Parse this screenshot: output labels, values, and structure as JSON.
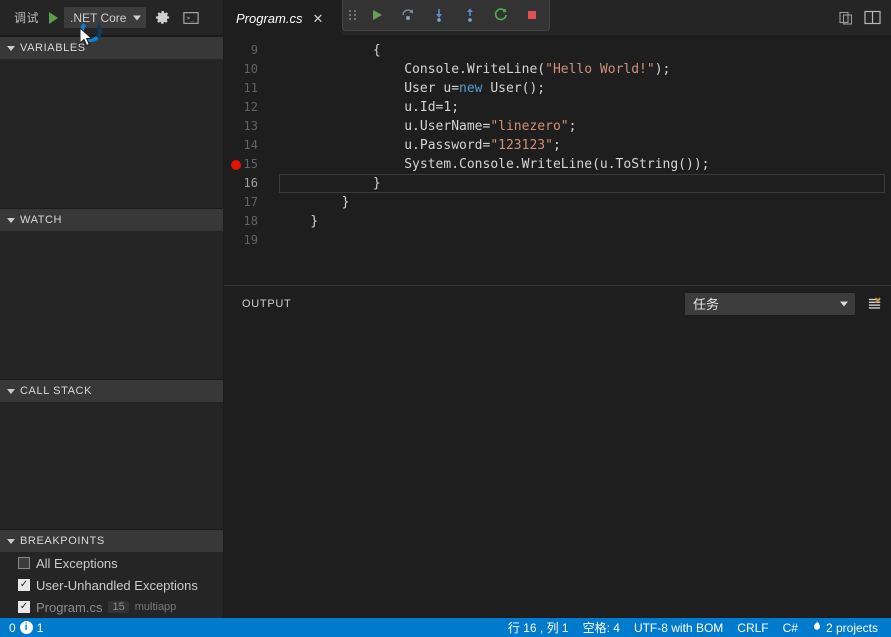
{
  "sidebar": {
    "debug_bar": {
      "label": "调试",
      "start_icon": "play-icon",
      "config_value": ".NET Core",
      "gear_icon": "gear-icon",
      "terminal_icon": "terminal-icon"
    },
    "sections": [
      {
        "title": "VARIABLES",
        "id": "variables"
      },
      {
        "title": "WATCH",
        "id": "watch"
      },
      {
        "title": "CALL STACK",
        "id": "call-stack"
      },
      {
        "title": "BREAKPOINTS",
        "id": "breakpoints"
      }
    ],
    "breakpoints": [
      {
        "label": "All Exceptions",
        "checked": false,
        "line": "",
        "project": "",
        "dim": false
      },
      {
        "label": "User-Unhandled Exceptions",
        "checked": true,
        "line": "",
        "project": "",
        "dim": false
      },
      {
        "label": "Program.cs",
        "checked": true,
        "line": "15",
        "project": "multiapp",
        "dim": true
      }
    ]
  },
  "tabbar": {
    "tabs": [
      {
        "label": "Program.cs",
        "close_icon": "close-icon",
        "active": true,
        "preview": true
      }
    ],
    "actions": [
      {
        "icon": "open-changes-icon",
        "name": "open-changes-button"
      },
      {
        "icon": "split-editor-icon",
        "name": "split-editor-button"
      }
    ]
  },
  "debug_toolbar": {
    "grip_icon": "drag-grip-icon",
    "buttons": [
      {
        "name": "continue-button",
        "icon": "play-icon",
        "label": "Continue"
      },
      {
        "name": "step-over-button",
        "icon": "step-over-icon",
        "label": "Step Over"
      },
      {
        "name": "step-into-button",
        "icon": "step-into-icon",
        "label": "Step Into"
      },
      {
        "name": "step-out-button",
        "icon": "step-out-icon",
        "label": "Step Out"
      },
      {
        "name": "restart-button",
        "icon": "restart-icon",
        "label": "Restart"
      },
      {
        "name": "stop-button",
        "icon": "stop-icon",
        "label": "Stop"
      }
    ]
  },
  "editor": {
    "language": "C#",
    "breakpoint_line": 15,
    "cursor_line": 16,
    "lines": [
      {
        "no": "9",
        "indent": 12,
        "tokens": [
          {
            "t": "{",
            "c": "pl"
          }
        ]
      },
      {
        "no": "10",
        "indent": 16,
        "tokens": [
          {
            "t": "Console.WriteLine(",
            "c": "pl"
          },
          {
            "t": "\"Hello World!\"",
            "c": "str"
          },
          {
            "t": ");",
            "c": "pl"
          }
        ]
      },
      {
        "no": "11",
        "indent": 16,
        "tokens": [
          {
            "t": "User u=",
            "c": "pl"
          },
          {
            "t": "new",
            "c": "kw"
          },
          {
            "t": " User();",
            "c": "pl"
          }
        ]
      },
      {
        "no": "12",
        "indent": 16,
        "tokens": [
          {
            "t": "u.Id=1;",
            "c": "pl"
          }
        ]
      },
      {
        "no": "13",
        "indent": 16,
        "tokens": [
          {
            "t": "u.UserName=",
            "c": "pl"
          },
          {
            "t": "\"linezero\"",
            "c": "str"
          },
          {
            "t": ";",
            "c": "pl"
          }
        ]
      },
      {
        "no": "14",
        "indent": 16,
        "tokens": [
          {
            "t": "u.Password=",
            "c": "pl"
          },
          {
            "t": "\"123123\"",
            "c": "str"
          },
          {
            "t": ";",
            "c": "pl"
          }
        ]
      },
      {
        "no": "15",
        "indent": 16,
        "tokens": [
          {
            "t": "System.Console.WriteLine(u.ToString());",
            "c": "pl"
          }
        ]
      },
      {
        "no": "16",
        "indent": 12,
        "tokens": [
          {
            "t": "}",
            "c": "pl"
          }
        ]
      },
      {
        "no": "17",
        "indent": 8,
        "tokens": [
          {
            "t": "}",
            "c": "pl"
          }
        ]
      },
      {
        "no": "18",
        "indent": 4,
        "tokens": [
          {
            "t": "}",
            "c": "pl"
          }
        ]
      },
      {
        "no": "19",
        "indent": 0,
        "tokens": []
      }
    ]
  },
  "panel": {
    "title": "OUTPUT",
    "channel_value": "任务",
    "clear_icon": "clear-output-icon",
    "content": ""
  },
  "statusbar": {
    "left": [
      {
        "name": "error-count",
        "icon": "error-icon",
        "value": "0"
      },
      {
        "name": "info-count",
        "icon": "info-icon",
        "value": "1"
      }
    ],
    "right": [
      {
        "name": "cursor-position",
        "value": "行 16 , 列 1"
      },
      {
        "name": "indentation",
        "value": "空格: 4"
      },
      {
        "name": "encoding",
        "value": "UTF-8 with BOM"
      },
      {
        "name": "eol",
        "value": "CRLF"
      },
      {
        "name": "language-mode",
        "value": "C#"
      },
      {
        "name": "projects",
        "value": "2 projects",
        "icon": "flame-icon"
      }
    ]
  },
  "colors": {
    "accent": "#007acc",
    "editor_bg": "#1e1e1e",
    "sidebar_bg": "#252526",
    "section_header_bg": "#383838",
    "breakpoint_red": "#e51400",
    "play_green": "#5f9e4e",
    "stop_red": "#e05252",
    "string_orange": "#ce9178",
    "keyword_blue": "#569cd6"
  }
}
